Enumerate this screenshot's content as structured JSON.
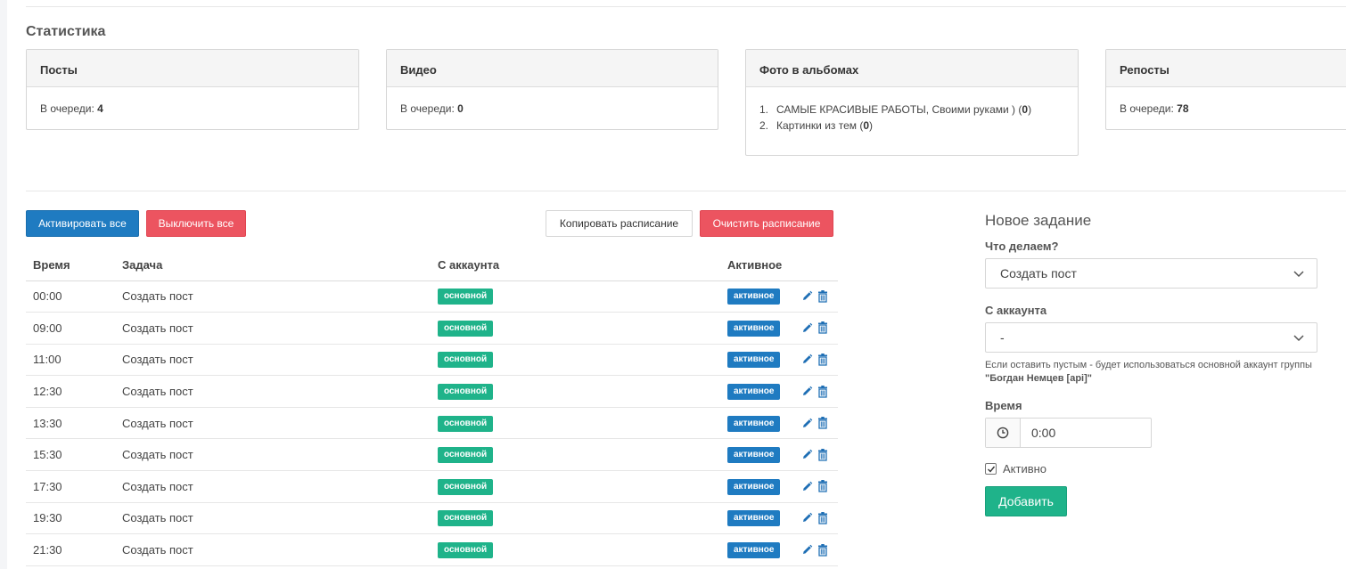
{
  "stats": {
    "title": "Статистика",
    "posts": {
      "title": "Посты",
      "queue_label": "В очереди:",
      "queue_value": "4"
    },
    "video": {
      "title": "Видео",
      "queue_label": "В очереди:",
      "queue_value": "0"
    },
    "albums": {
      "title": "Фото в альбомах",
      "items": [
        {
          "num": "1.",
          "name": "САМЫЕ КРАСИВЫЕ РАБОТЫ, Своими руками )",
          "count": "0"
        },
        {
          "num": "2.",
          "name": "Картинки из тем",
          "count": "0"
        }
      ]
    },
    "reposts": {
      "title": "Репосты",
      "queue_label": "В очереди:",
      "queue_value": "78"
    }
  },
  "toolbar": {
    "activate_all": "Активировать все",
    "disable_all": "Выключить все",
    "copy_schedule": "Копировать расписание",
    "clear_schedule": "Очистить расписание"
  },
  "table": {
    "headers": {
      "time": "Время",
      "task": "Задача",
      "account": "С аккаунта",
      "active": "Активное"
    },
    "rows": [
      {
        "time": "00:00",
        "task": "Создать пост",
        "account": "основной",
        "status": "активное"
      },
      {
        "time": "09:00",
        "task": "Создать пост",
        "account": "основной",
        "status": "активное"
      },
      {
        "time": "11:00",
        "task": "Создать пост",
        "account": "основной",
        "status": "активное"
      },
      {
        "time": "12:30",
        "task": "Создать пост",
        "account": "основной",
        "status": "активное"
      },
      {
        "time": "13:30",
        "task": "Создать пост",
        "account": "основной",
        "status": "активное"
      },
      {
        "time": "15:30",
        "task": "Создать пост",
        "account": "основной",
        "status": "активное"
      },
      {
        "time": "17:30",
        "task": "Создать пост",
        "account": "основной",
        "status": "активное"
      },
      {
        "time": "19:30",
        "task": "Создать пост",
        "account": "основной",
        "status": "активное"
      },
      {
        "time": "21:30",
        "task": "Создать пост",
        "account": "основной",
        "status": "активное"
      }
    ]
  },
  "form": {
    "title": "Новое задание",
    "what_label": "Что делаем?",
    "what_value": "Создать пост",
    "account_label": "С аккаунта",
    "account_value": "-",
    "hint_text": "Если оставить пустым - будет использоваться основной аккаунт группы ",
    "hint_account": "\"Богдан Немцев [api]\"",
    "time_label": "Время",
    "time_value": "0:00",
    "active_label": "Активно",
    "active_checked": true,
    "submit": "Добавить"
  },
  "colors": {
    "primary": "#1f7bc1",
    "danger": "#ec5460",
    "success": "#1fb38a"
  },
  "icons": {
    "edit": "pencil-icon",
    "delete": "trash-icon",
    "dropdown": "chevron-down-icon",
    "clock": "clock-icon",
    "check": "check-icon"
  }
}
